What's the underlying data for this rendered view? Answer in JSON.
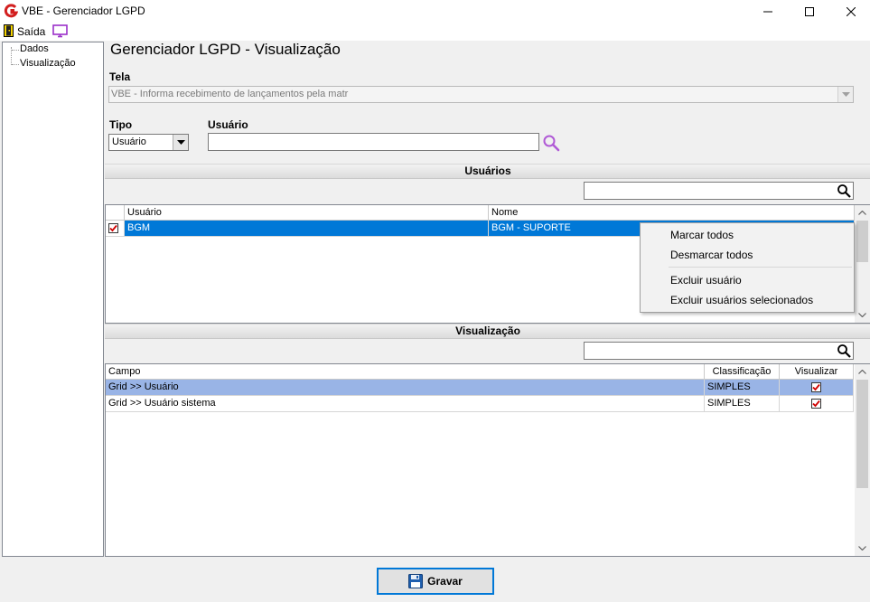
{
  "window": {
    "title": "VBE - Gerenciador LGPD",
    "icon": "app-logo-icon",
    "controls": [
      "minimize-icon",
      "maximize-icon",
      "close-icon"
    ]
  },
  "menu": {
    "exit_label": "Saída",
    "exit_icon": "exit-door-icon",
    "monitor_icon": "monitor-icon"
  },
  "tree": {
    "items": [
      "Dados",
      "Visualização"
    ]
  },
  "page": {
    "title": "Gerenciador LGPD - Visualização"
  },
  "form": {
    "tela_label": "Tela",
    "tela_value": "VBE - Informa recebimento de lançamentos pela matr",
    "tipo_label": "Tipo",
    "tipo_value": "Usuário",
    "usuario_label": "Usuário",
    "usuario_value": ""
  },
  "usuarios": {
    "section_title": "Usuários",
    "filter_value": "",
    "columns": [
      "Usuário",
      "Nome"
    ],
    "rows": [
      {
        "checked": true,
        "usuario": "BGM",
        "nome": "BGM - SUPORTE"
      }
    ]
  },
  "context_menu": {
    "items": [
      "Marcar todos",
      "Desmarcar todos",
      "Excluir usuário",
      "Excluir usuários selecionados"
    ]
  },
  "visualizacao": {
    "section_title": "Visualização",
    "filter_value": "",
    "columns": [
      "Campo",
      "Classificação",
      "Visualizar"
    ],
    "rows": [
      {
        "campo": "Grid >> Usuário",
        "classificacao": "SIMPLES",
        "visualizar": true
      },
      {
        "campo": "Grid >> Usuário sistema",
        "classificacao": "SIMPLES",
        "visualizar": true
      }
    ]
  },
  "footer": {
    "save_label": "Gravar",
    "save_icon": "floppy-disk-icon"
  },
  "colors": {
    "selection": "#0078d7",
    "selection_alt": "#99b4e6",
    "check_red": "#d00000",
    "search_icon": "#b05ad6"
  }
}
